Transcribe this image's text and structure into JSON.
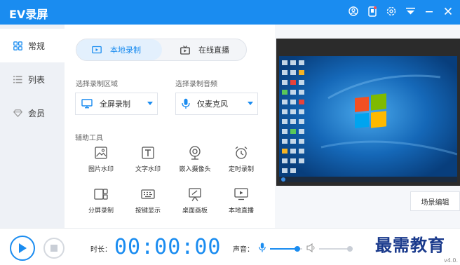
{
  "window": {
    "title": "EV录屏"
  },
  "titlebar_icons": [
    "user-icon",
    "phone-icon",
    "settings-icon",
    "menu-icon",
    "minimize-icon",
    "close-icon"
  ],
  "sidebar": {
    "items": [
      {
        "label": "常规",
        "icon": "grid-icon",
        "active": true
      },
      {
        "label": "列表",
        "icon": "list-icon",
        "active": false
      },
      {
        "label": "会员",
        "icon": "diamond-icon",
        "active": false
      }
    ]
  },
  "mode_tabs": [
    {
      "label": "本地录制",
      "icon": "record-icon",
      "active": true
    },
    {
      "label": "在线直播",
      "icon": "live-icon",
      "active": false
    }
  ],
  "record_area": {
    "label": "选择录制区域",
    "value": "全屏录制",
    "icon": "monitor-icon"
  },
  "record_audio": {
    "label": "选择录制音频",
    "value": "仅麦克风",
    "icon": "mic-icon"
  },
  "tools": {
    "label": "辅助工具",
    "items": [
      {
        "label": "图片水印",
        "icon": "image-icon"
      },
      {
        "label": "文字水印",
        "icon": "text-icon"
      },
      {
        "label": "嵌入摄像头",
        "icon": "camera-icon"
      },
      {
        "label": "定时录制",
        "icon": "alarm-icon"
      },
      {
        "label": "分屏录制",
        "icon": "split-screen-icon"
      },
      {
        "label": "按键显示",
        "icon": "keyboard-icon"
      },
      {
        "label": "桌面画板",
        "icon": "whiteboard-icon"
      },
      {
        "label": "本地直播",
        "icon": "local-live-icon"
      }
    ]
  },
  "preview": {
    "scene_button": "场景编辑"
  },
  "bottom": {
    "duration_label": "时长：",
    "timer": "00:00:00",
    "sound_label": "声音：",
    "mic_volume": 0.85,
    "system_volume": 1.0,
    "watermark": "最需教育",
    "version": "v4.0."
  },
  "colors": {
    "accent": "#1a8cf0",
    "titlebar": "#1a8cf0",
    "desktop": "#0d5fa8"
  }
}
